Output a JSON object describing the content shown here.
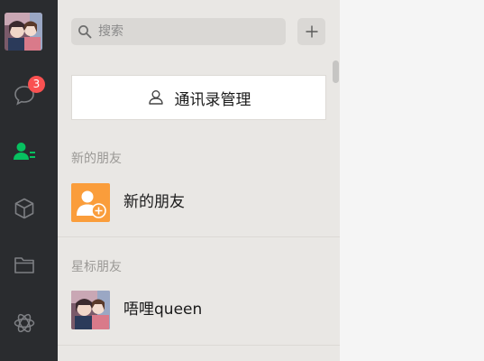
{
  "nav": {
    "items": [
      {
        "icon": "chat-icon",
        "badge": "3"
      },
      {
        "icon": "contacts-icon"
      },
      {
        "icon": "box-icon"
      },
      {
        "icon": "folder-icon"
      },
      {
        "icon": "miniprogram-icon"
      }
    ],
    "active_color": "#07c160"
  },
  "search": {
    "placeholder": "搜索",
    "add_label": "+"
  },
  "contacts_manage": {
    "label": "通讯录管理"
  },
  "sections": [
    {
      "header": "新的朋友",
      "items": [
        {
          "name": "新的朋友",
          "avatar_color": "#fa9d3b",
          "icon": "add-friend-icon"
        }
      ]
    },
    {
      "header": "星标朋友",
      "items": [
        {
          "name": "唔哩queen",
          "icon": "user-avatar"
        }
      ]
    }
  ]
}
